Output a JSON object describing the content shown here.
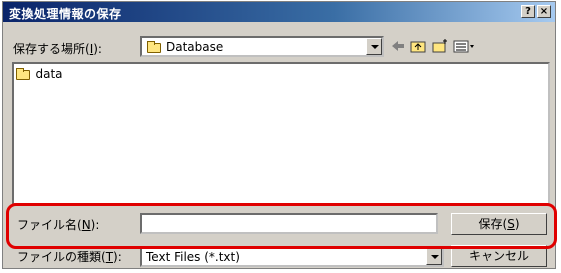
{
  "window": {
    "title": "変換処理情報の保存",
    "help_btn": "?",
    "close_btn": "×"
  },
  "location": {
    "label_pre": "保存する場所(",
    "label_key": "I",
    "label_post": "):",
    "value": "Database"
  },
  "file_list": {
    "items": [
      {
        "name": "data"
      }
    ]
  },
  "filename": {
    "label_pre": "ファイル名(",
    "label_key": "N",
    "label_post": "):",
    "value": ""
  },
  "filetype": {
    "label_pre": "ファイルの種類(",
    "label_key": "T",
    "label_post": "):",
    "value": "Text Files (*.txt)"
  },
  "buttons": {
    "save_pre": "保存(",
    "save_key": "S",
    "save_post": ")",
    "cancel": "キャンセル"
  },
  "toolbar_icons": [
    "back-arrow-icon",
    "up-folder-icon",
    "new-folder-icon",
    "view-menu-icon"
  ],
  "highlight_color": "#e00000"
}
